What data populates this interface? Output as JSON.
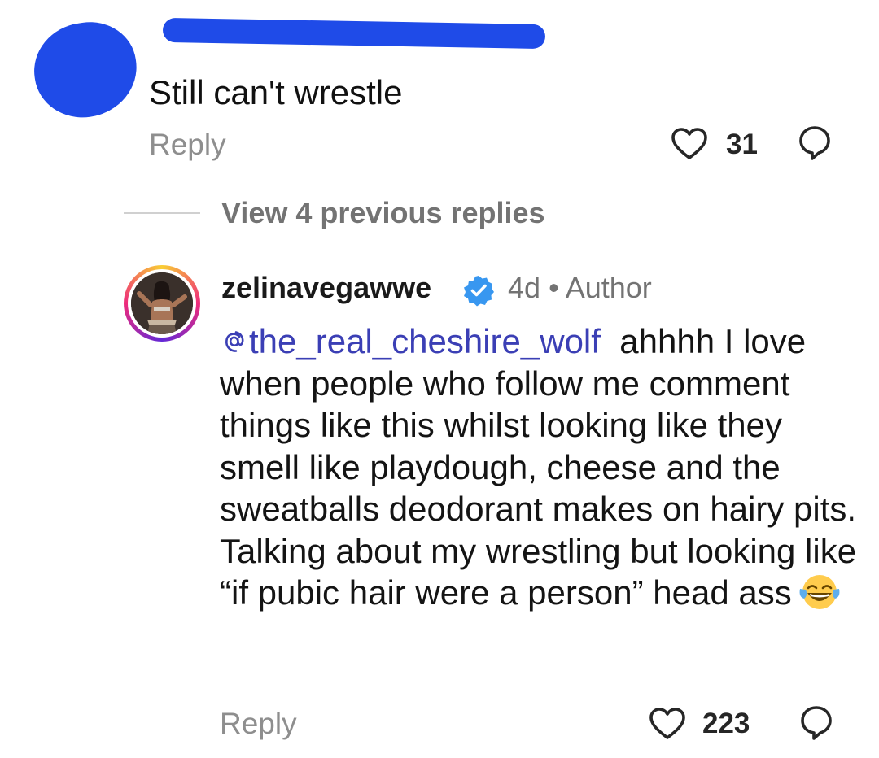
{
  "comment": {
    "text": "Still can't wrestle",
    "reply_label": "Reply",
    "like_count": "31"
  },
  "thread": {
    "view_previous_label": "View 4 previous replies"
  },
  "author_reply": {
    "username": "zelinavegawwe",
    "time": "4d",
    "separator": "•",
    "role": "Author",
    "mention": "the_real_cheshire_wolf",
    "body": "ahhhh I love when people who follow me comment things like this whilst looking like they smell like playdough, cheese and the sweatballs deodorant makes on hairy pits. Talking about my wrestling but looking like “if pubic hair were a person” head ass",
    "emoji": "face-with-tears-of-joy",
    "reply_label": "Reply",
    "like_count": "223"
  },
  "colors": {
    "redaction": "#1f4be8",
    "mention": "#3b3fb5",
    "verified": "#3897f0",
    "secondary_text": "#8e8e8e"
  },
  "icons": [
    "heart-icon",
    "comment-bubble-icon",
    "verified-badge-icon",
    "threads-at-icon",
    "laughing-emoji-icon"
  ]
}
